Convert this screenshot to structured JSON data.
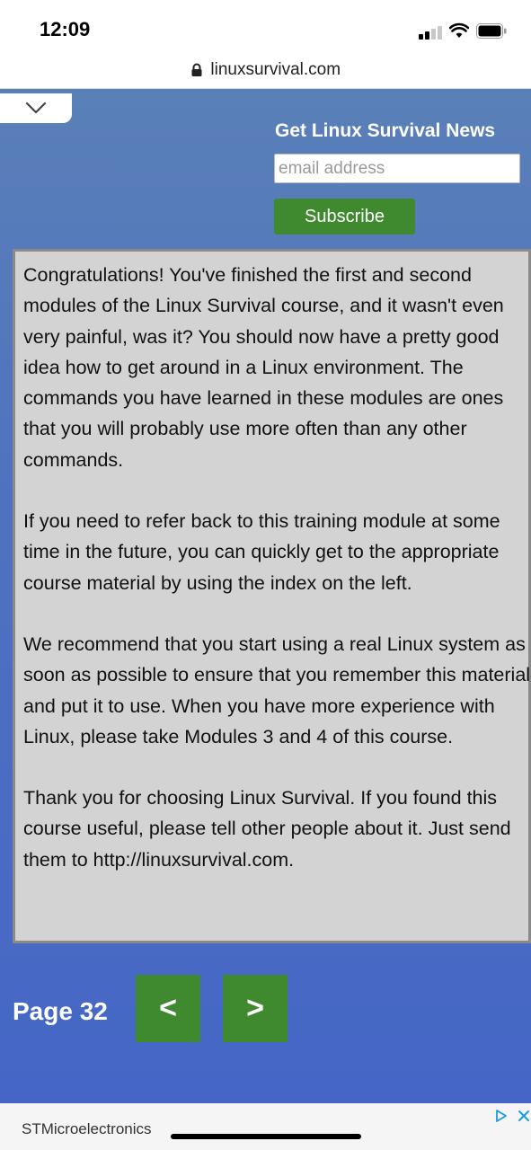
{
  "status_bar": {
    "time": "12:09"
  },
  "browser": {
    "url": "linuxsurvival.com"
  },
  "newsletter": {
    "title": "Get Linux Survival News",
    "email_placeholder": "email address",
    "subscribe_label": "Subscribe",
    "button_color": "#3f8a2e"
  },
  "content": {
    "paragraphs": [
      "Congratulations! You've finished the first and second modules of the Linux Survival course, and it wasn't even very painful, was it? You should now have a pretty good idea how to get around in a Linux environment. The commands you have learned in these modules are ones that you will probably use more often than any other commands.",
      "If you need to refer back to this training module at some time in the future, you can quickly get to the appropriate course material by using the index on the left.",
      "We recommend that you start using a real Linux system as soon as possible to ensure that you remember this material and put it to use. When you have more experience with Linux, please take Modules 3 and 4 of this course.",
      "Thank you for choosing Linux Survival. If you found this course useful, please tell other people about it. Just send them to http://linuxsurvival.com."
    ]
  },
  "pagination": {
    "page_label": "Page 32",
    "prev_label": "<",
    "next_label": ">"
  },
  "ad": {
    "advertiser": "STMicroelectronics",
    "icons": [
      "ad-choices-icon",
      "close-icon"
    ]
  },
  "icons": {
    "collapse": "chevron-down-icon",
    "lock": "lock-icon"
  }
}
